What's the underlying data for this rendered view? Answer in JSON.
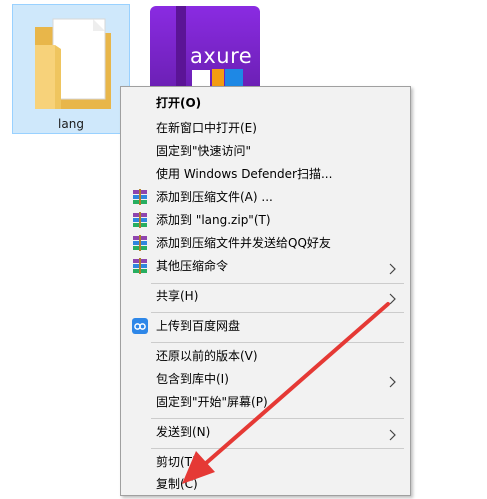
{
  "desktop": {
    "folder": {
      "label": "lang",
      "icon": "folder-icon",
      "selected": true
    },
    "app_icon": {
      "logo_text": "axure",
      "icon": "axure-rp-icon"
    }
  },
  "context_menu": {
    "items": [
      {
        "label": "打开(O)",
        "bold": true
      },
      {
        "label": "在新窗口中打开(E)"
      },
      {
        "label": "固定到\"快速访问\""
      },
      {
        "label": "使用 Windows Defender扫描..."
      },
      {
        "label": "添加到压缩文件(A) ...",
        "icon": "winrar-icon"
      },
      {
        "label": "添加到 \"lang.zip\"(T)",
        "icon": "winrar-icon"
      },
      {
        "label": "添加到压缩文件并发送给QQ好友",
        "icon": "winrar-icon"
      },
      {
        "label": "其他压缩命令",
        "icon": "winrar-icon",
        "submenu": true
      },
      {
        "label": "共享(H)",
        "submenu": true
      },
      {
        "label": "上传到百度网盘",
        "icon": "baidu-netdisk-icon"
      },
      {
        "label": "还原以前的版本(V)"
      },
      {
        "label": "包含到库中(I)",
        "submenu": true
      },
      {
        "label": "固定到\"开始\"屏幕(P)"
      },
      {
        "label": "发送到(N)",
        "submenu": true
      },
      {
        "label": "剪切(T)"
      },
      {
        "label": "复制(C)"
      }
    ]
  },
  "colors": {
    "menu_background": "#f2f2f2",
    "menu_border": "#a0a0a0",
    "selection_background": "#cfe8fb",
    "selection_border": "#99d1ff",
    "annotation_arrow": "#e53935",
    "axure_purple": "#7b22cc"
  },
  "annotation": {
    "type": "arrow",
    "points_to": "复制(C)",
    "color": "#e53935"
  }
}
